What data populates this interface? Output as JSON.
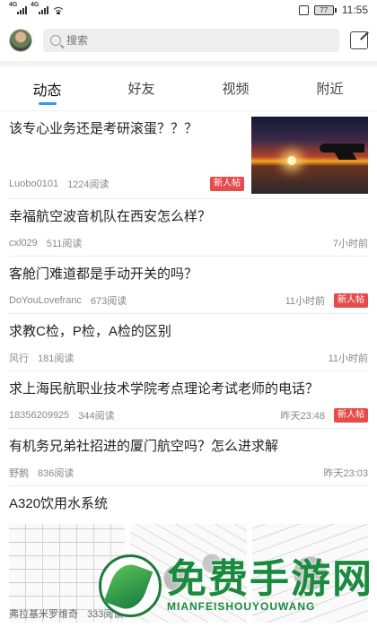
{
  "status_bar": {
    "signal_1": "4G",
    "signal_2": "4G",
    "battery": "77",
    "time": "11:55"
  },
  "search": {
    "placeholder": "搜索"
  },
  "tabs": [
    {
      "label": "动态",
      "active": true
    },
    {
      "label": "好友",
      "active": false
    },
    {
      "label": "视频",
      "active": false
    },
    {
      "label": "附近",
      "active": false
    }
  ],
  "posts": [
    {
      "title": "该专心业务还是考研滚蛋？？？",
      "author": "Luobo0101",
      "views": "1224阅读",
      "time": "",
      "badge": "新人帖"
    },
    {
      "title": "幸福航空波音机队在西安怎么样？",
      "author": "cxl029",
      "views": "511阅读",
      "time": "7小时前",
      "badge": ""
    },
    {
      "title": "客舱门难道都是手动开关的吗？",
      "author": "DoYouLovefranc",
      "views": "673阅读",
      "time": "11小时前",
      "badge": "新人帖"
    },
    {
      "title": "求教C检，P检，A检的区别",
      "author": "风行",
      "views": "181阅读",
      "time": "11小时前",
      "badge": ""
    },
    {
      "title": "求上海民航职业技术学院考点理论考试老师的电话？",
      "author": "18356209925",
      "views": "344阅读",
      "time": "昨天23:48",
      "badge": "新人帖"
    },
    {
      "title": "有机务兄弟社招进的厦门航空吗？怎么进求解",
      "author": "野鹅",
      "views": "836阅读",
      "time": "昨天23:03",
      "badge": ""
    },
    {
      "title": "A320饮用水系统",
      "author": "弗拉基米罗维奇",
      "views": "333阅读",
      "time": "",
      "badge": ""
    }
  ],
  "watermark": {
    "title": "免费手游网",
    "subtitle": "MIANFEISHOUYOUWANG"
  },
  "colors": {
    "accent": "#2f9bea",
    "badge": "#e64c4c",
    "watermark": "#1a8a3e"
  }
}
